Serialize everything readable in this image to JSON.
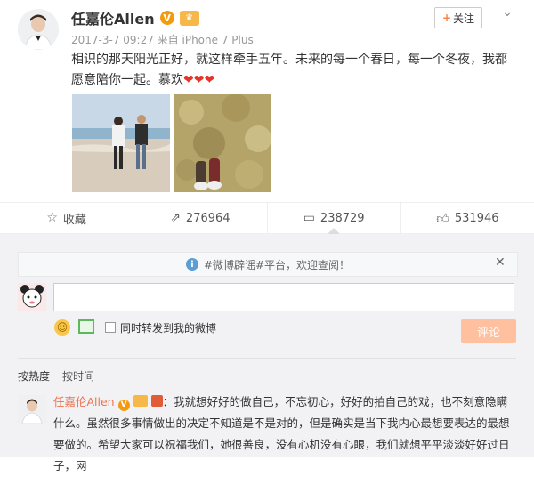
{
  "post": {
    "author": "任嘉伦Allen",
    "meta": "2017-3-7 09:27 来自 iPhone 7 Plus",
    "follow_label": "关注",
    "text": "相识的那天阳光正好，就这样牵手五年。未来的每一个春日，每一个冬夜，我都愿意陪你一起。慕欢",
    "hearts": "❤❤❤"
  },
  "actions": {
    "favorite_label": "收藏",
    "repost_count": "276964",
    "comment_count": "238729",
    "like_count": "531946"
  },
  "comment_box": {
    "notice": "#微博辟谣#平台，欢迎查阅！",
    "repost_label": "同时转发到我的微博",
    "submit_label": "评论"
  },
  "sort": {
    "hot": "按热度",
    "time": "按时间"
  },
  "comment": {
    "author": "任嘉伦Allen",
    "text": "：我就想好好的做自己，不忘初心，好好的拍自己的戏，也不刻意隐瞒什么。虽然很多事情做出的决定不知道是不是对的，但是确实是当下我内心最想要表达的最想要做的。希望大家可以祝福我们，她很善良，没有心机没有心眼，我们就想平平淡淡好好过日子，网"
  },
  "colors": {
    "accent_orange": "#eb7350",
    "submit_disabled": "#ffc09f",
    "heart_red": "#e8332a",
    "verified": "#f49a11"
  },
  "icons": [
    "star-icon",
    "repost-icon",
    "comment-icon",
    "like-icon",
    "info-icon",
    "close-icon",
    "emoji-icon",
    "image-icon",
    "chevron-down-icon"
  ]
}
